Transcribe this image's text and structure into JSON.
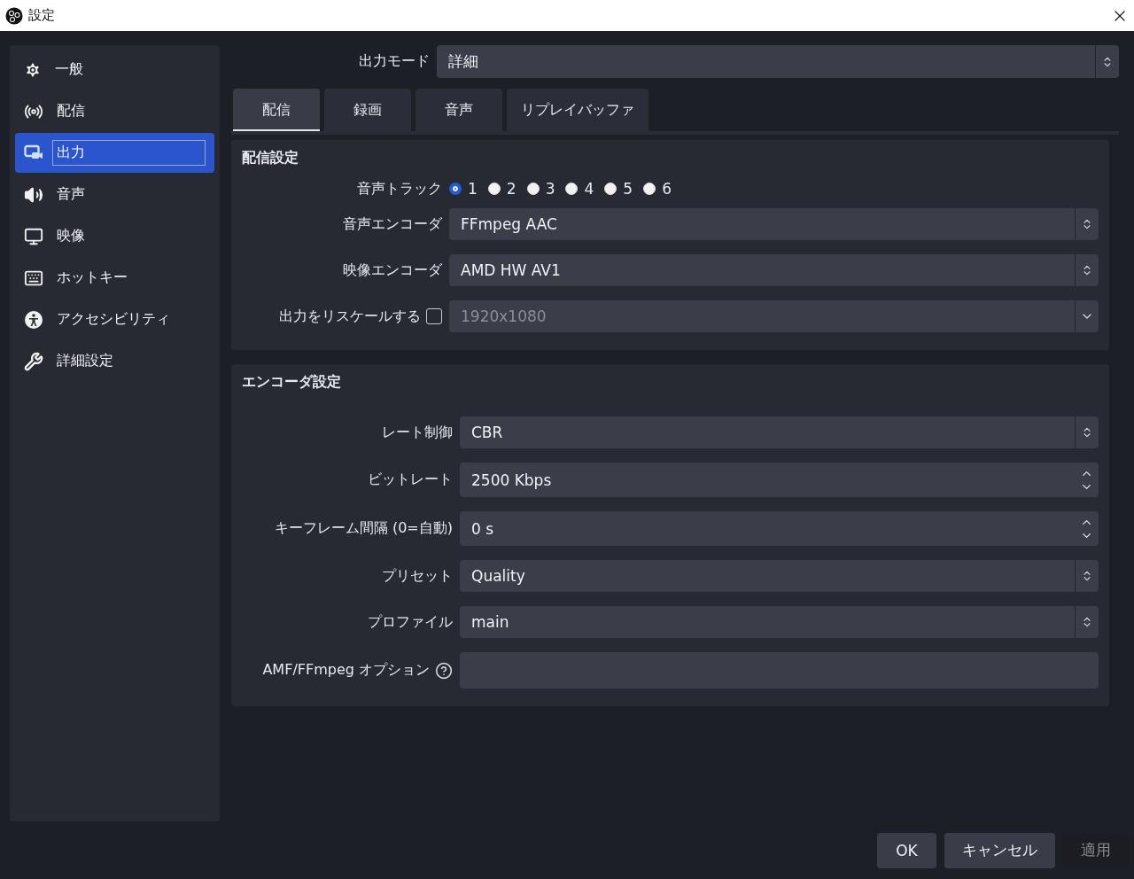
{
  "window": {
    "title": "設定"
  },
  "sidebar": {
    "items": [
      {
        "label": "一般",
        "selected": false
      },
      {
        "label": "配信",
        "selected": false
      },
      {
        "label": "出力",
        "selected": true
      },
      {
        "label": "音声",
        "selected": false
      },
      {
        "label": "映像",
        "selected": false
      },
      {
        "label": "ホットキー",
        "selected": false
      },
      {
        "label": "アクセシビリティ",
        "selected": false
      },
      {
        "label": "詳細設定",
        "selected": false
      }
    ]
  },
  "output_mode": {
    "label": "出力モード",
    "value": "詳細"
  },
  "tabs": [
    {
      "label": "配信",
      "selected": true
    },
    {
      "label": "録画",
      "selected": false
    },
    {
      "label": "音声",
      "selected": false
    },
    {
      "label": "リプレイバッファ",
      "selected": false
    }
  ],
  "stream_section": {
    "title": "配信設定",
    "audio_track": {
      "label": "音声トラック",
      "options": [
        {
          "label": "1",
          "selected": true
        },
        {
          "label": "2",
          "selected": false
        },
        {
          "label": "3",
          "selected": false
        },
        {
          "label": "4",
          "selected": false
        },
        {
          "label": "5",
          "selected": false
        },
        {
          "label": "6",
          "selected": false
        }
      ]
    },
    "fields": [
      {
        "kind": "select",
        "label": "音声エンコーダ",
        "value": "FFmpeg AAC"
      },
      {
        "kind": "select",
        "label": "映像エンコーダ",
        "value": "AMD HW AV1"
      },
      {
        "kind": "checkselect",
        "label": "出力をリスケールする",
        "checked": false,
        "value": "1920x1080"
      }
    ]
  },
  "encoder_section": {
    "title": "エンコーダ設定",
    "fields": [
      {
        "kind": "select",
        "label": "レート制御",
        "value": "CBR"
      },
      {
        "kind": "spin",
        "label": "ビットレート",
        "value": "2500 Kbps"
      },
      {
        "kind": "spin",
        "label": "キーフレーム間隔 (0=自動)",
        "value": "0 s"
      },
      {
        "kind": "select",
        "label": "プリセット",
        "value": "Quality"
      },
      {
        "kind": "select",
        "label": "プロファイル",
        "value": "main"
      },
      {
        "kind": "text",
        "label": "AMF/FFmpeg オプション",
        "help": true
      }
    ]
  },
  "buttons": [
    {
      "label": "OK",
      "disabled": false
    },
    {
      "label": "キャンセル",
      "disabled": false
    },
    {
      "label": "適用",
      "disabled": true
    }
  ]
}
